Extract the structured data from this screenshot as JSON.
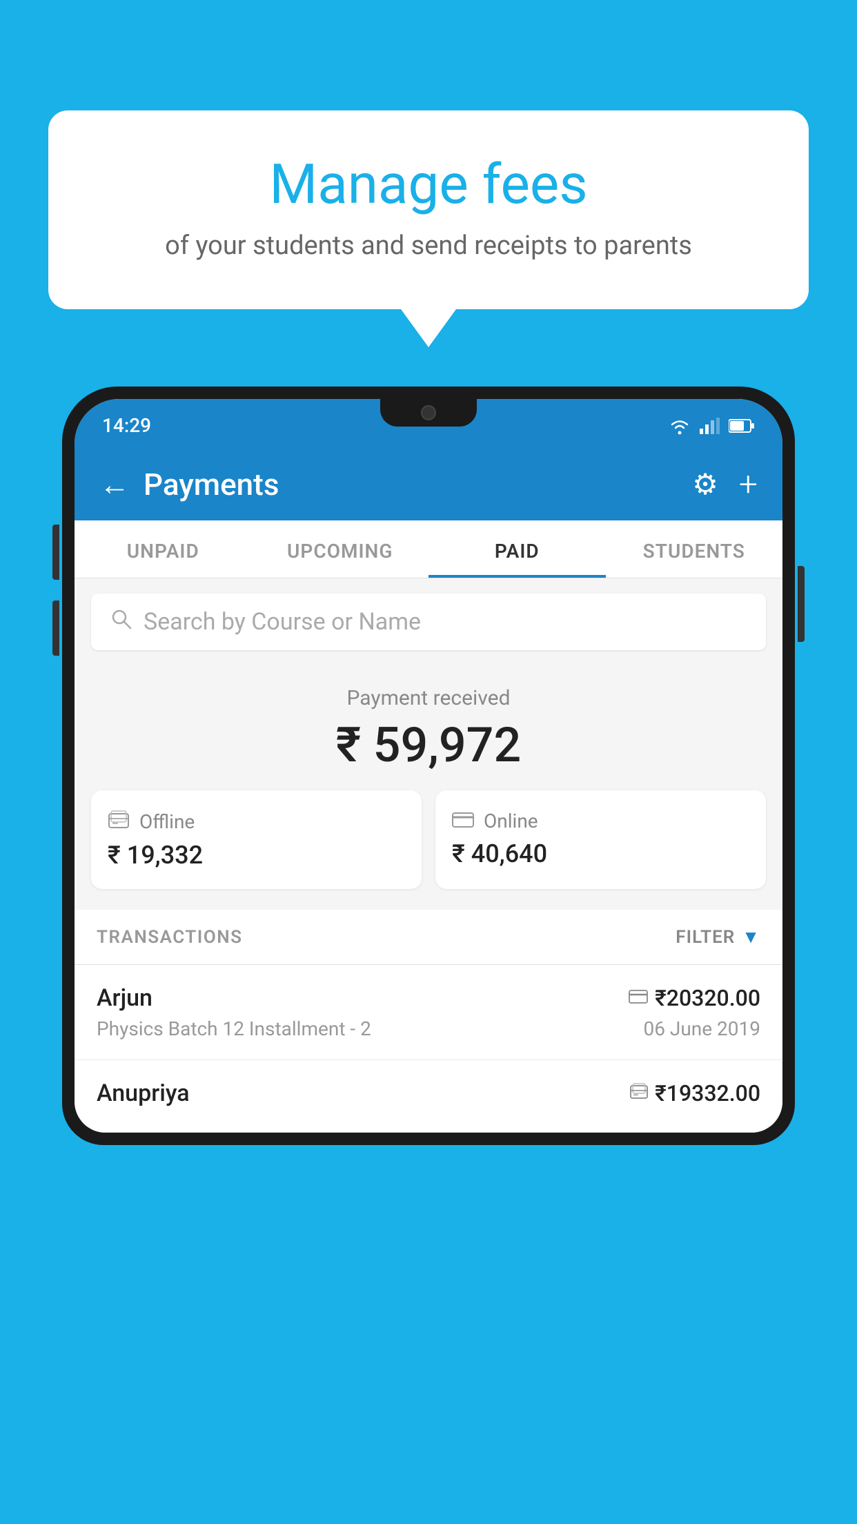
{
  "background_color": "#1ab0e8",
  "bubble": {
    "title": "Manage fees",
    "subtitle": "of your students and send receipts to parents"
  },
  "status_bar": {
    "time": "14:29"
  },
  "header": {
    "title": "Payments",
    "back_label": "←",
    "settings_label": "⚙",
    "add_label": "+"
  },
  "tabs": [
    {
      "label": "UNPAID",
      "active": false
    },
    {
      "label": "UPCOMING",
      "active": false
    },
    {
      "label": "PAID",
      "active": true
    },
    {
      "label": "STUDENTS",
      "active": false
    }
  ],
  "search": {
    "placeholder": "Search by Course or Name"
  },
  "payment_summary": {
    "label": "Payment received",
    "amount": "₹ 59,972",
    "cards": [
      {
        "icon": "₹",
        "type": "Offline",
        "amount": "₹ 19,332"
      },
      {
        "icon": "▭",
        "type": "Online",
        "amount": "₹ 40,640"
      }
    ]
  },
  "transactions": {
    "label": "TRANSACTIONS",
    "filter_label": "FILTER",
    "rows": [
      {
        "name": "Arjun",
        "course": "Physics Batch 12 Installment - 2",
        "amount": "₹20320.00",
        "date": "06 June 2019",
        "type_icon": "▭"
      },
      {
        "name": "Anupriya",
        "course": "",
        "amount": "₹19332.00",
        "date": "",
        "type_icon": "₹"
      }
    ]
  }
}
